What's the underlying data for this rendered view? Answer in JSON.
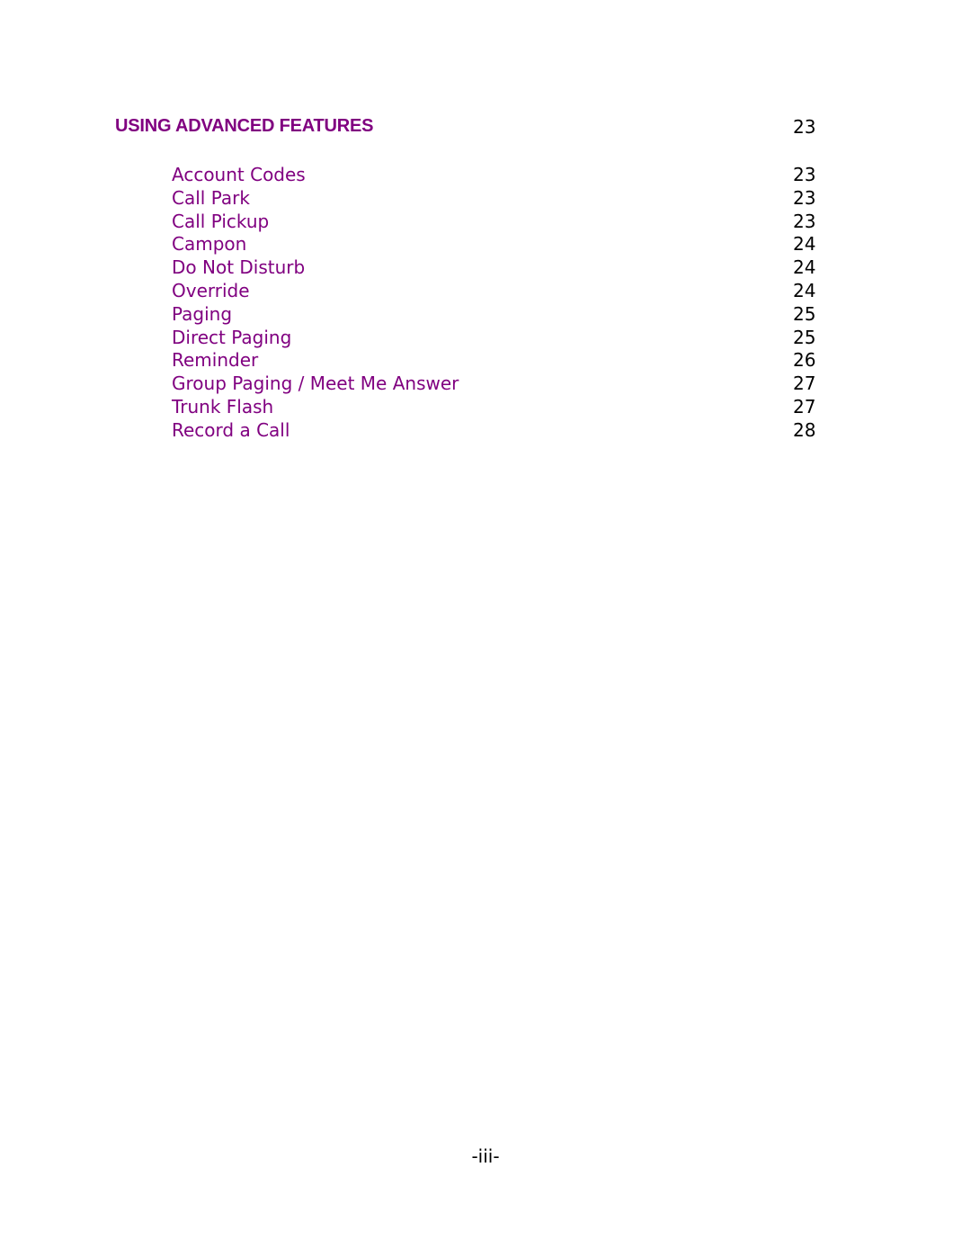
{
  "section": {
    "title": "USING ADVANCED FEATURES",
    "page": "23",
    "color": "#800080"
  },
  "entries": [
    {
      "label": "Account Codes",
      "page": "23"
    },
    {
      "label": "Call Park",
      "page": "23"
    },
    {
      "label": "Call Pickup",
      "page": "23"
    },
    {
      "label": "Campon",
      "page": "24"
    },
    {
      "label": "Do Not Disturb",
      "page": "24"
    },
    {
      "label": "Override",
      "page": "24"
    },
    {
      "label": "Paging",
      "page": "25"
    },
    {
      "label": "Direct Paging",
      "page": "25"
    },
    {
      "label": "Reminder",
      "page": "26"
    },
    {
      "label": "Group Paging / Meet Me Answer",
      "page": "27"
    },
    {
      "label": "Trunk Flash",
      "page": "27"
    },
    {
      "label": "Record a Call",
      "page": "28"
    }
  ],
  "footer": {
    "page_number": "-iii-"
  }
}
